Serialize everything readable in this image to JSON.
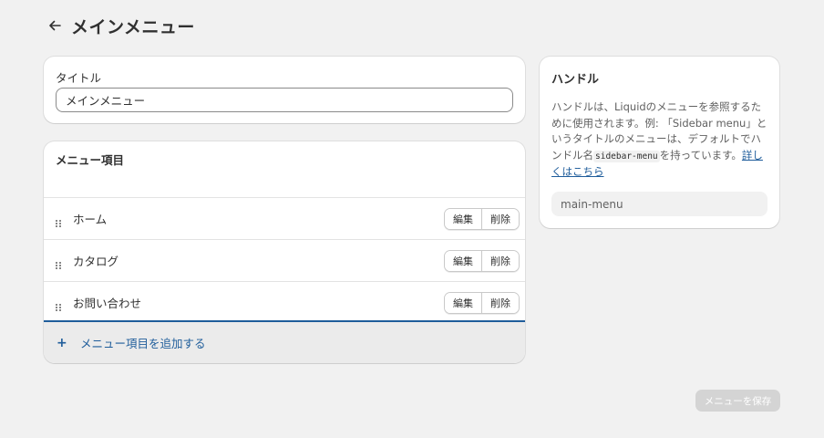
{
  "header": {
    "title": "メインメニュー",
    "back_icon": "arrow-left-icon"
  },
  "title_card": {
    "label": "タイトル",
    "value": "メインメニュー"
  },
  "menu_card": {
    "heading": "メニュー項目",
    "items": [
      {
        "label": "ホーム",
        "edit_label": "編集",
        "delete_label": "削除"
      },
      {
        "label": "カタログ",
        "edit_label": "編集",
        "delete_label": "削除"
      },
      {
        "label": "お問い合わせ",
        "edit_label": "編集",
        "delete_label": "削除"
      }
    ],
    "add_label": "メニュー項目を追加する",
    "add_icon": "+"
  },
  "handle_card": {
    "title": "ハンドル",
    "desc_prefix": "ハンドルは、Liquidのメニューを参照するために使用されます。例: 「Sidebar menu」というタイトルのメニューは、デフォルトでハンドル名",
    "desc_code": "sidebar-menu",
    "desc_suffix": "を持っています。",
    "learn_more": "詳しくはこちら",
    "handle_value": "main-menu"
  },
  "footer": {
    "save_label": "メニューを保存"
  },
  "colors": {
    "background": "#f1f1f1",
    "link": "#1f5d9b",
    "save_disabled": "#d4d4d4"
  }
}
